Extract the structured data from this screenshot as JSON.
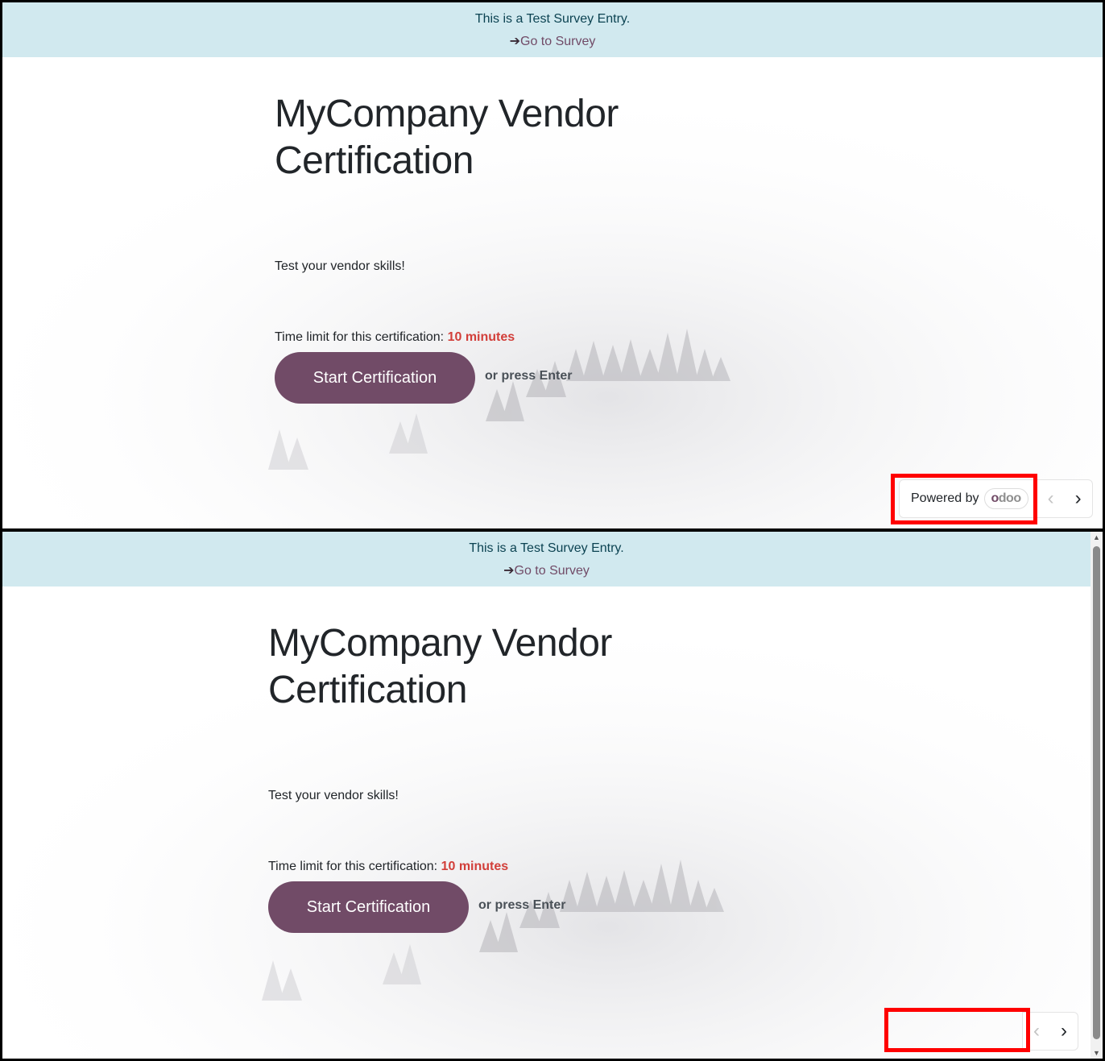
{
  "banner": {
    "text": "This is a Test Survey Entry.",
    "link_arrow": "➔",
    "link_label": "Go to Survey"
  },
  "survey": {
    "title": "MyCompany Vendor Certification",
    "description": "Test your vendor skills!",
    "time_label": "Time limit for this certification:",
    "time_value": "10 minutes",
    "start_label": "Start Certification",
    "hint": "or press Enter"
  },
  "footer": {
    "powered_by": "Powered by",
    "brand_prefix": "o",
    "brand_rest": "doo",
    "prev_icon": "‹",
    "next_icon": "›"
  },
  "colors": {
    "accent": "#714b67",
    "banner_bg": "#d1e9ef",
    "time_value": "#d23f3a",
    "highlight": "#ff0000"
  }
}
